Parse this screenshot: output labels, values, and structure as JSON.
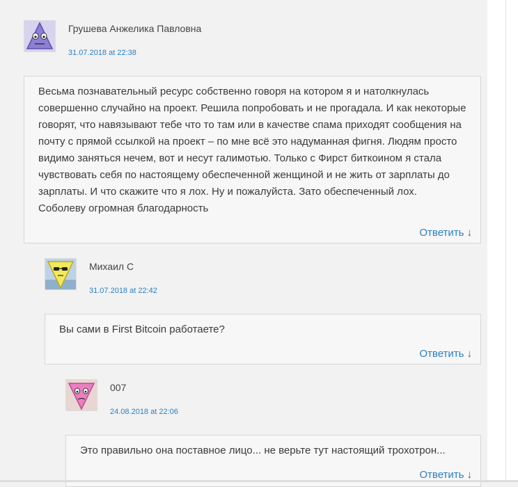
{
  "comments": [
    {
      "author": "Грушева Анжелика Павловна",
      "date": "31.07.2018 at 22:38",
      "avatar_icon": "purple-triangle-face-avatar",
      "text": "Весьма познавательный ресурс собственно говоря на котором я и натолкнулась совершенно случайно на проект. Решила попробовать и не прогадала. И как некоторые говорят, что навязывают тебе что то там или в качестве спама приходят сообщения на почту с прямой ссылкой на проект – по мне всё это надуманная фигня. Людям просто видимо заняться нечем, вот и несут галимотью. Только с Фирст биткоином я стала чувствовать себя по настоящему обеспеченной женщиной и не жить от зарплаты до зарплаты. И что скажите что я лох. Ну и пожалуйста. Зато обеспеченный лох. Соболеву огромная благодарность",
      "reply_label": "Ответить",
      "reply_arrow": "↓"
    },
    {
      "author": "Михаил С",
      "date": "31.07.2018 at 22:42",
      "avatar_icon": "yellow-triangle-sunglasses-avatar",
      "text": "Вы сами в First Bitcoin работаете?",
      "reply_label": "Ответить",
      "reply_arrow": "↓"
    },
    {
      "author": "007",
      "date": "24.08.2018 at 22:06",
      "avatar_icon": "pink-triangle-face-avatar",
      "text": "Это правильно она поставное лицо... не верьте тут настоящий трохотрон...",
      "reply_label": "Ответить",
      "reply_arrow": "↓"
    }
  ],
  "colors": {
    "link": "#2a7fc1",
    "background": "#f2f2f2",
    "bubble": "#f7f7f7",
    "bubble_border": "#d6d6d6"
  }
}
